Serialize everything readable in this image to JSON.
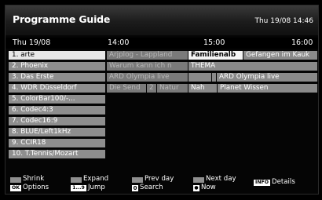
{
  "header": {
    "title": "Programme Guide",
    "clock": "Thu 19/08 14:46"
  },
  "timebar": {
    "date": "Thu 19/08",
    "times": [
      "14:00",
      "15:00",
      "16:00"
    ]
  },
  "channels": [
    "1. arte",
    "2. Phoenix",
    "3. Das Erste",
    "4. WDR Düsseldorf",
    "5. ColorBar100/-...",
    "6. Codec4:3",
    "7. Codec16:9",
    "8. BLUE/Left1kHz",
    "9. CCIR18",
    "10. T.Tennis/Mozart"
  ],
  "programmes": {
    "row1": [
      "Arjplog - Lappland",
      "Familienalb",
      "Gefangen im Kauk"
    ],
    "row2": [
      "Warum kann ich n",
      "THEMA"
    ],
    "row3": [
      "ARD Olympia live",
      "",
      "ARD Olympia live"
    ],
    "row4": [
      "Die Send",
      "2",
      "Natur",
      "Nah",
      "Planet Wissen"
    ]
  },
  "footer": {
    "shrink": "Shrink",
    "options_key": "OK",
    "options": "Options",
    "expand": "Expand",
    "jump_key": "1...9",
    "jump": "Jump",
    "prev_day": "Prev day",
    "search_key": "0",
    "search": "Search",
    "next_day": "Next day",
    "now": "Now",
    "info_key": "INFO",
    "details": "Details"
  }
}
